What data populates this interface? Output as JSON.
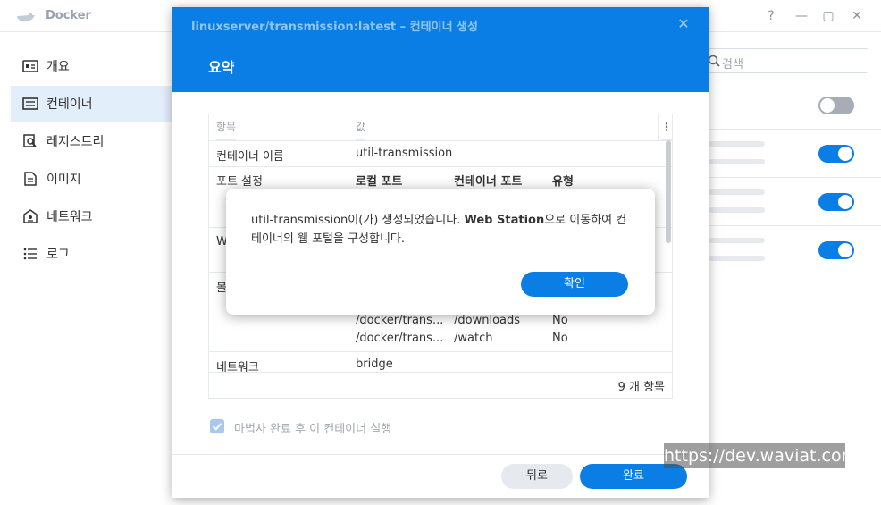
{
  "app": {
    "title": "Docker",
    "window_buttons": [
      "?",
      "—",
      "▢",
      "✕"
    ]
  },
  "sidebar": {
    "items": [
      {
        "label": "개요",
        "icon": "overview-icon",
        "active": false
      },
      {
        "label": "컨테이너",
        "icon": "container-list-icon",
        "active": true
      },
      {
        "label": "레지스트리",
        "icon": "registry-search-icon",
        "active": false
      },
      {
        "label": "이미지",
        "icon": "image-icon",
        "active": false
      },
      {
        "label": "네트워크",
        "icon": "network-icon",
        "active": false
      },
      {
        "label": "로그",
        "icon": "log-list-icon",
        "active": false
      }
    ]
  },
  "right_panel": {
    "search_placeholder": "검색",
    "toggles": [
      "off",
      "on",
      "on",
      "on"
    ]
  },
  "wizard": {
    "title": "linuxserver/transmission:latest – 컨테이너 생성",
    "step": "요약",
    "table": {
      "headers": [
        "항목",
        "값"
      ],
      "rows": {
        "name_label": "컨테이너 이름",
        "name_value": "util-transmission",
        "port_label": "포트 설정",
        "port_headers": [
          "로컬 포트",
          "컨테이너 포트",
          "유형"
        ],
        "web_label_partial": "W",
        "volume_label_partial": "볼",
        "volume_rows": [
          {
            "local": "/docker/trans...",
            "container": "/downloads",
            "readonly": "No"
          },
          {
            "local": "/docker/trans...",
            "container": "/watch",
            "readonly": "No"
          }
        ],
        "network_label": "네트워크",
        "network_value": "bridge"
      },
      "count": "9 개 항목"
    },
    "run_after_label": "마법사 완료 후 이 컨테이너 실행",
    "run_after_checked": true,
    "back_button": "뒤로",
    "finish_button": "완료"
  },
  "dialog": {
    "message_part1": "util-transmission이(가) 생성되었습니다. ",
    "message_bold": "Web Station",
    "message_part2": "으로 이동하여 컨테이너의 웹 포털을 구성합니다.",
    "ok_button": "확인"
  },
  "watermark": "https://dev.waviat.com",
  "colors": {
    "accent": "#0a7ee5",
    "active_nav_bg": "#e3eefb",
    "toggle_off": "#a7adb4"
  }
}
